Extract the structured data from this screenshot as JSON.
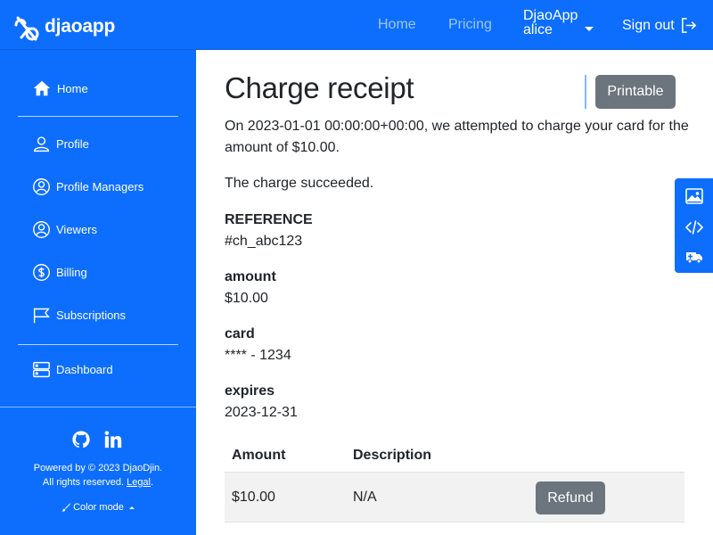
{
  "brand": {
    "name": "djaoapp"
  },
  "topnav": {
    "home": "Home",
    "pricing": "Pricing",
    "org_name": "DjaoApp",
    "username": "alice",
    "signout": "Sign out"
  },
  "sidebar": {
    "items": [
      {
        "label": "Home",
        "icon": "house-icon"
      },
      {
        "label": "Profile",
        "icon": "person-icon"
      },
      {
        "label": "Profile Managers",
        "icon": "person-circle-icon"
      },
      {
        "label": "Viewers",
        "icon": "person-circle-icon"
      },
      {
        "label": "Billing",
        "icon": "dollar-circle-icon"
      },
      {
        "label": "Subscriptions",
        "icon": "flag-icon"
      },
      {
        "label": "Dashboard",
        "icon": "server-icon"
      }
    ],
    "footer": {
      "powered_by": "Powered by © 2023 DjaoDjin.",
      "rights": "All rights reserved.",
      "legal": "Legal",
      "color_mode": "Color mode"
    }
  },
  "receipt": {
    "title": "Charge receipt",
    "printable": "Printable",
    "intro": "On 2023-01-01 00:00:00+00:00, we attempted to charge your card for the amount of $10.00.",
    "status": "The charge succeeded.",
    "reference_label": "REFERENCE",
    "reference_value": "#ch_abc123",
    "amount_label": "amount",
    "amount_value": "$10.00",
    "card_label": "card",
    "card_value": "**** - 1234",
    "expires_label": "expires",
    "expires_value": "2023-12-31",
    "table": {
      "headers": [
        "Amount",
        "Description"
      ],
      "rows": [
        {
          "amount": "$10.00",
          "description": "N/A",
          "action": "Refund"
        }
      ]
    }
  },
  "colors": {
    "primary": "#0d6efd",
    "secondary_button": "#6c757d",
    "row_bg": "#f2f2f2"
  }
}
